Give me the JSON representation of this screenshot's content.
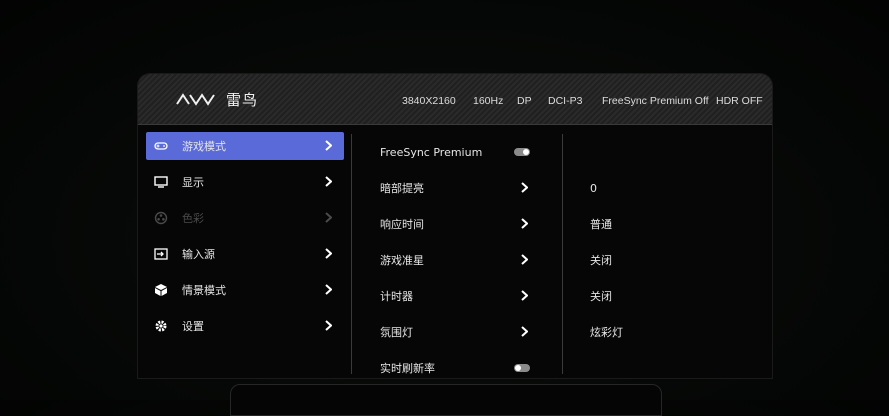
{
  "header": {
    "brand": "雷鸟",
    "status": {
      "resolution": "3840X2160",
      "refresh": "160Hz",
      "input": "DP",
      "gamut": "DCI-P3",
      "freesync": "FreeSync Premium Off",
      "hdr": "HDR OFF"
    }
  },
  "menu": {
    "items": [
      {
        "label": "游戏模式",
        "icon": "gamepad-icon",
        "state": "active"
      },
      {
        "label": "显示",
        "icon": "display-icon",
        "state": "normal"
      },
      {
        "label": "色彩",
        "icon": "color-icon",
        "state": "disabled"
      },
      {
        "label": "输入源",
        "icon": "input-source-icon",
        "state": "normal"
      },
      {
        "label": "情景模式",
        "icon": "cube-icon",
        "state": "normal"
      },
      {
        "label": "设置",
        "icon": "gear-icon",
        "state": "normal"
      }
    ]
  },
  "submenu": {
    "items": [
      {
        "label": "FreeSync Premium",
        "control": "toggle",
        "toggle_state": "on"
      },
      {
        "label": "暗部提亮",
        "control": "chevron"
      },
      {
        "label": "响应时间",
        "control": "chevron"
      },
      {
        "label": "游戏准星",
        "control": "chevron"
      },
      {
        "label": "计时器",
        "control": "chevron"
      },
      {
        "label": "氛围灯",
        "control": "chevron"
      },
      {
        "label": "实时刷新率",
        "control": "toggle",
        "toggle_state": "off"
      }
    ]
  },
  "values": {
    "items": [
      "",
      "0",
      "普通",
      "关闭",
      "关闭",
      "炫彩灯",
      ""
    ]
  },
  "colors": {
    "accent": "#5a6ad8",
    "panel": "#060606",
    "text": "#e6e6e6",
    "disabled_text": "#4a4a4a"
  }
}
